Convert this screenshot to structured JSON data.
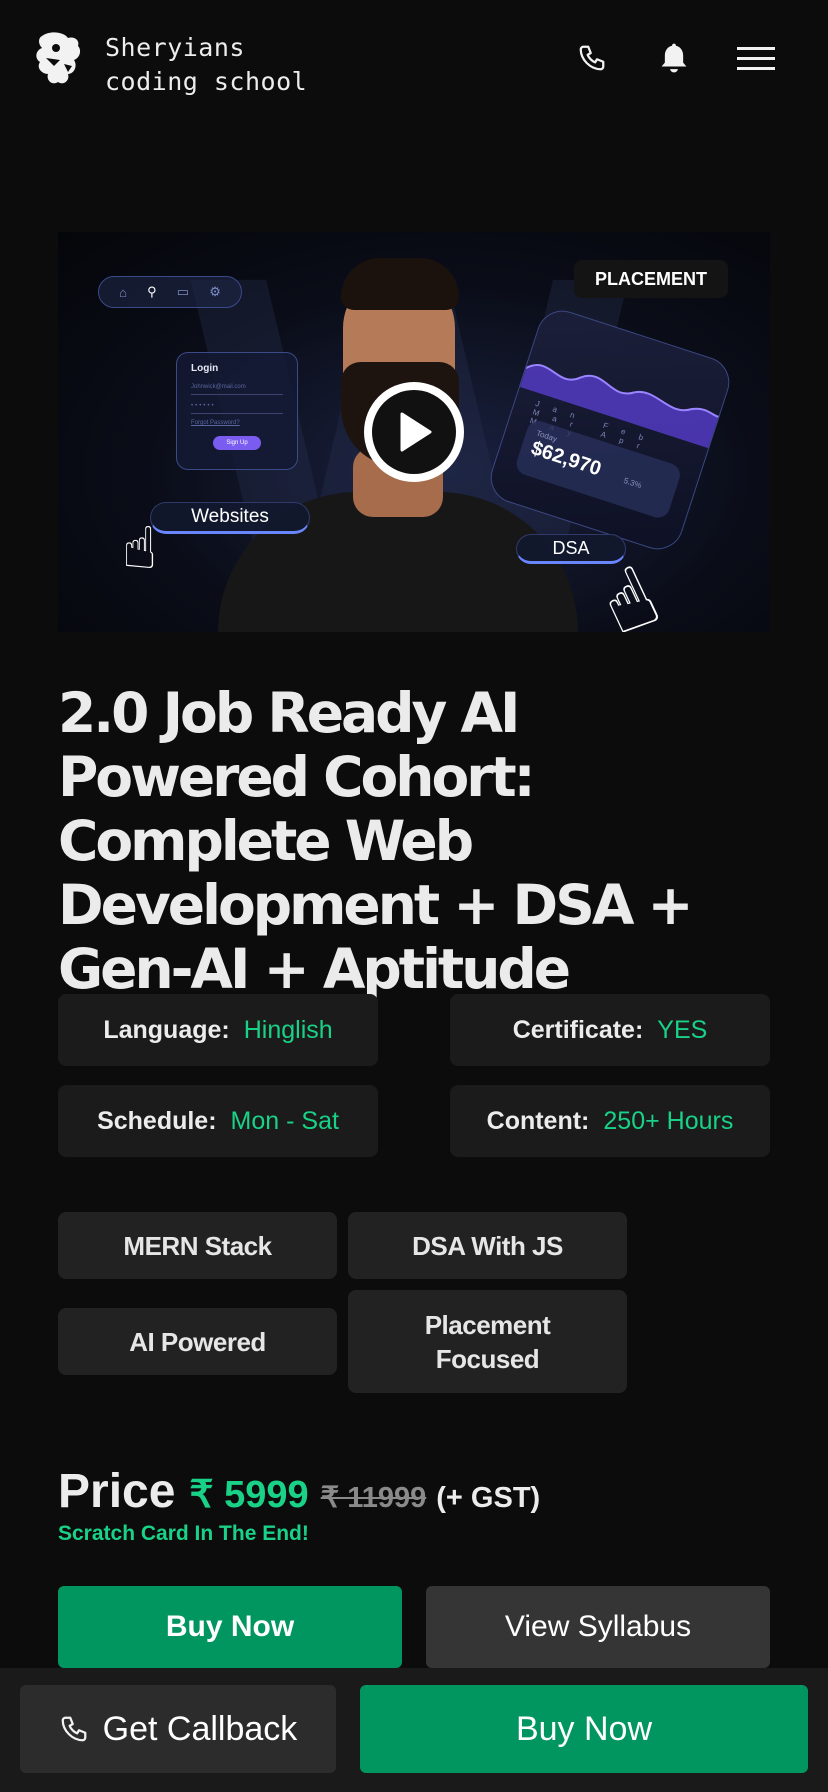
{
  "header": {
    "brand_line1": "Sheryians",
    "brand_line2": "coding school",
    "icons": [
      "logo-icon",
      "phone-icon",
      "bell-icon",
      "menu-icon"
    ]
  },
  "video": {
    "tags": {
      "placement": "PLACEMENT",
      "websites": "Websites",
      "dsa": "DSA"
    },
    "login_card": {
      "title": "Login",
      "email": "Johnwick@mail.com",
      "forgot": "Forgot Password?",
      "signup": "Sign Up"
    },
    "stats_card": {
      "months": "Jan Feb Mar Apr May",
      "today": "Today",
      "amount": "$62,970",
      "change": "5.3%"
    }
  },
  "course": {
    "title": "2.0 Job Ready AI Powered Cohort: Complete Web Development + DSA + Gen-AI + Aptitude"
  },
  "info": [
    {
      "key": "Language:",
      "value": "Hinglish"
    },
    {
      "key": "Certificate:",
      "value": "YES"
    },
    {
      "key": "Schedule:",
      "value": "Mon - Sat"
    },
    {
      "key": "Content:",
      "value": "250+ Hours"
    }
  ],
  "tags": [
    "MERN Stack",
    "DSA With JS",
    "AI Powered",
    "Placement Focused"
  ],
  "price": {
    "label": "Price",
    "current": "₹ 5999",
    "original": "₹ 11999",
    "gst": "(+ GST)",
    "note": "Scratch Card In The End!"
  },
  "actions": {
    "buy_now": "Buy Now",
    "view_syllabus": "View Syllabus"
  },
  "bottom_bar": {
    "callback": "Get Callback",
    "buy_now": "Buy Now"
  },
  "colors": {
    "accent_green": "#19d187",
    "button_green": "#01965f",
    "background": "#0c0c0c"
  }
}
